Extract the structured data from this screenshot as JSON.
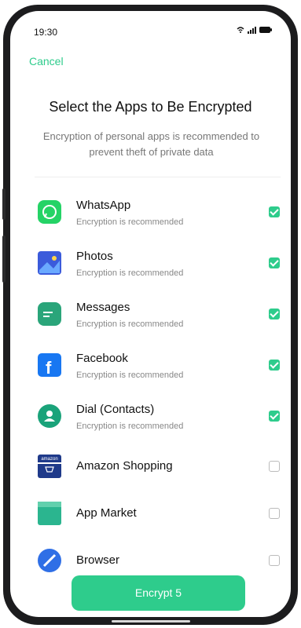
{
  "status_bar": {
    "time": "19:30"
  },
  "header": {
    "cancel_label": "Cancel",
    "title": "Select the Apps to Be Encrypted",
    "subtitle": "Encryption of personal apps is recommended to prevent theft of private data"
  },
  "apps": [
    {
      "name": "WhatsApp",
      "subtitle": "Encryption is recommended",
      "checked": true,
      "icon": "whatsapp-icon",
      "color": "#25d366"
    },
    {
      "name": "Photos",
      "subtitle": "Encryption is recommended",
      "checked": true,
      "icon": "photos-icon",
      "color": "#3b5bdb"
    },
    {
      "name": "Messages",
      "subtitle": "Encryption is recommended",
      "checked": true,
      "icon": "messages-icon",
      "color": "#2aa57a"
    },
    {
      "name": "Facebook",
      "subtitle": "Encryption is recommended",
      "checked": true,
      "icon": "facebook-icon",
      "color": "#1877f2"
    },
    {
      "name": "Dial (Contacts)",
      "subtitle": "Encryption is recommended",
      "checked": true,
      "icon": "contacts-icon",
      "color": "#1aa37a"
    },
    {
      "name": "Amazon Shopping",
      "subtitle": "",
      "checked": false,
      "icon": "amazon-icon",
      "color": "#1f3a8a",
      "icon_text": "amazon"
    },
    {
      "name": "App Market",
      "subtitle": "",
      "checked": false,
      "icon": "app-market-icon",
      "color": "#2bb58f"
    },
    {
      "name": "Browser",
      "subtitle": "",
      "checked": false,
      "icon": "browser-icon",
      "color": "#2f6fe6"
    }
  ],
  "encrypt_button": {
    "label": "Encrypt 5"
  },
  "colors": {
    "accent": "#2ecc8c"
  }
}
